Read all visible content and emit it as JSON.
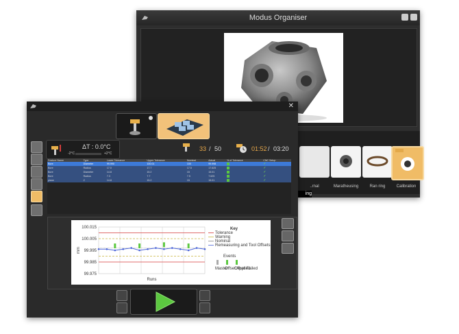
{
  "back_window": {
    "title": "Modus Organiser",
    "thumbnails": [
      {
        "label": "..rnal"
      },
      {
        "label": "Maratheusing"
      },
      {
        "label": "Ran ring"
      },
      {
        "label": "Calibration"
      }
    ],
    "partial_label": "ing"
  },
  "front_window": {
    "delta_title": "ΔT : 0.0°C",
    "delta_low": "-2°C",
    "delta_high": "+2°C",
    "part_count": "33",
    "part_total": "50",
    "time_elapsed": "01:52",
    "time_total": "03:20",
    "sep": "/"
  },
  "table": {
    "headers": [
      "Feature Name",
      "Type",
      "Lower Tolerance",
      "Upper Tolerance",
      "Nominal",
      "Actual",
      "% of Tolerance",
      "CNC Setup"
    ],
    "rows": [
      [
        "Bore",
        "Diameter",
        "99.990",
        "100.01",
        "100",
        "99.998",
        "",
        ""
      ],
      [
        "Bore",
        "Radius",
        "17.0",
        "17.7",
        "17.5",
        "17.625",
        "",
        ""
      ],
      [
        "Bore",
        "Diameter",
        "14.8",
        "15.2",
        "15",
        "15.01",
        "",
        ""
      ],
      [
        "Bore",
        "Radius",
        "7.3",
        "7.7",
        "7.5",
        "7.625",
        "",
        ""
      ],
      [
        "plane",
        "Z",
        "14.8",
        "15.2",
        "15",
        "15.01",
        "",
        ""
      ]
    ]
  },
  "chart_data": {
    "type": "line",
    "ylabel": "mm",
    "xlabel": "Runs",
    "y_ticks": [
      "100.015",
      "100.005",
      "99.995",
      "99.985",
      "99.975"
    ],
    "ylim": [
      99.975,
      100.015
    ],
    "key_title": "Key",
    "key_items": [
      "Tolerance",
      "Warning",
      "Nominal",
      "Remeasuring and Tool Offsets"
    ],
    "events_title": "Events",
    "event_items": [
      "Master",
      "Offset Applied",
      "Offset Failed"
    ],
    "series": [
      {
        "values": [
          99.996,
          99.996,
          99.995,
          99.996,
          99.997,
          99.995,
          99.996,
          99.997,
          99.996,
          99.997,
          99.996,
          99.995,
          99.997,
          99.996
        ]
      }
    ],
    "tolerance": [
      99.985,
      100.01
    ],
    "warning": [
      99.99,
      100.005
    ],
    "nominal": 99.997,
    "colors": {
      "tolerance": "#d63d3d",
      "warning": "#c8b43c",
      "series": "#4a64d8"
    }
  }
}
